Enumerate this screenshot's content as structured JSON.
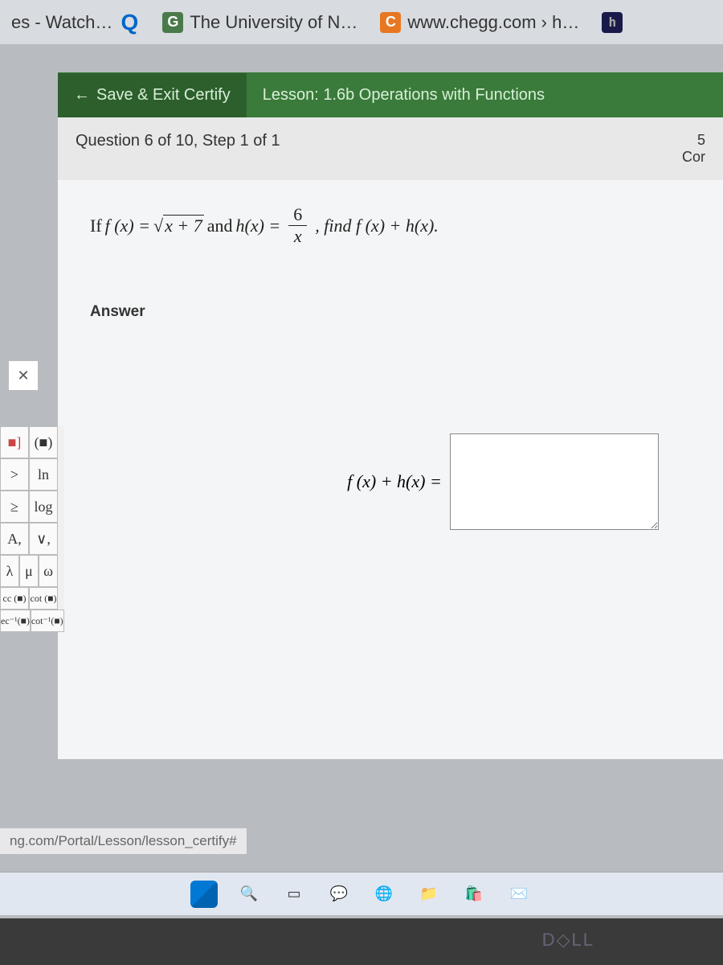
{
  "tabs": [
    {
      "label": "es - Watch…",
      "icon": "q"
    },
    {
      "label": "The University of N…",
      "icon": "G"
    },
    {
      "label": "www.chegg.com › h…",
      "icon": "C"
    },
    {
      "label": "",
      "icon": "h"
    }
  ],
  "header": {
    "save_exit": "Save & Exit Certify",
    "lesson": "Lesson: 1.6b Operations with Functions"
  },
  "question_bar": {
    "label": "Question 6 of 10, Step 1 of 1",
    "score_num": "5",
    "score_label": "Cor"
  },
  "problem": {
    "prefix": "If ",
    "fx": "f (x) = ",
    "sqrt_sym": "√",
    "radicand": "x + 7",
    "and": " and ",
    "hx": "h(x) = ",
    "frac_num": "6",
    "frac_den": "x",
    "suffix": ", find f (x) + h(x)."
  },
  "answer": {
    "label": "Answer",
    "lhs": "f (x) + h(x) =",
    "value": ""
  },
  "keypad": {
    "close": "✕",
    "rows": [
      [
        "■]",
        "(■)"
      ],
      [
        ">",
        "ln"
      ],
      [
        "≥",
        "log"
      ],
      [
        "A,",
        "∨,"
      ],
      [
        "λ",
        "μ",
        "ω"
      ]
    ],
    "trig1": [
      "cc (■)",
      "cot (■)"
    ],
    "trig2": [
      "ec⁻¹(■)",
      "cot⁻¹(■)"
    ]
  },
  "url_hint": "ng.com/Portal/Lesson/lesson_certify#",
  "dell": "D◇LL"
}
